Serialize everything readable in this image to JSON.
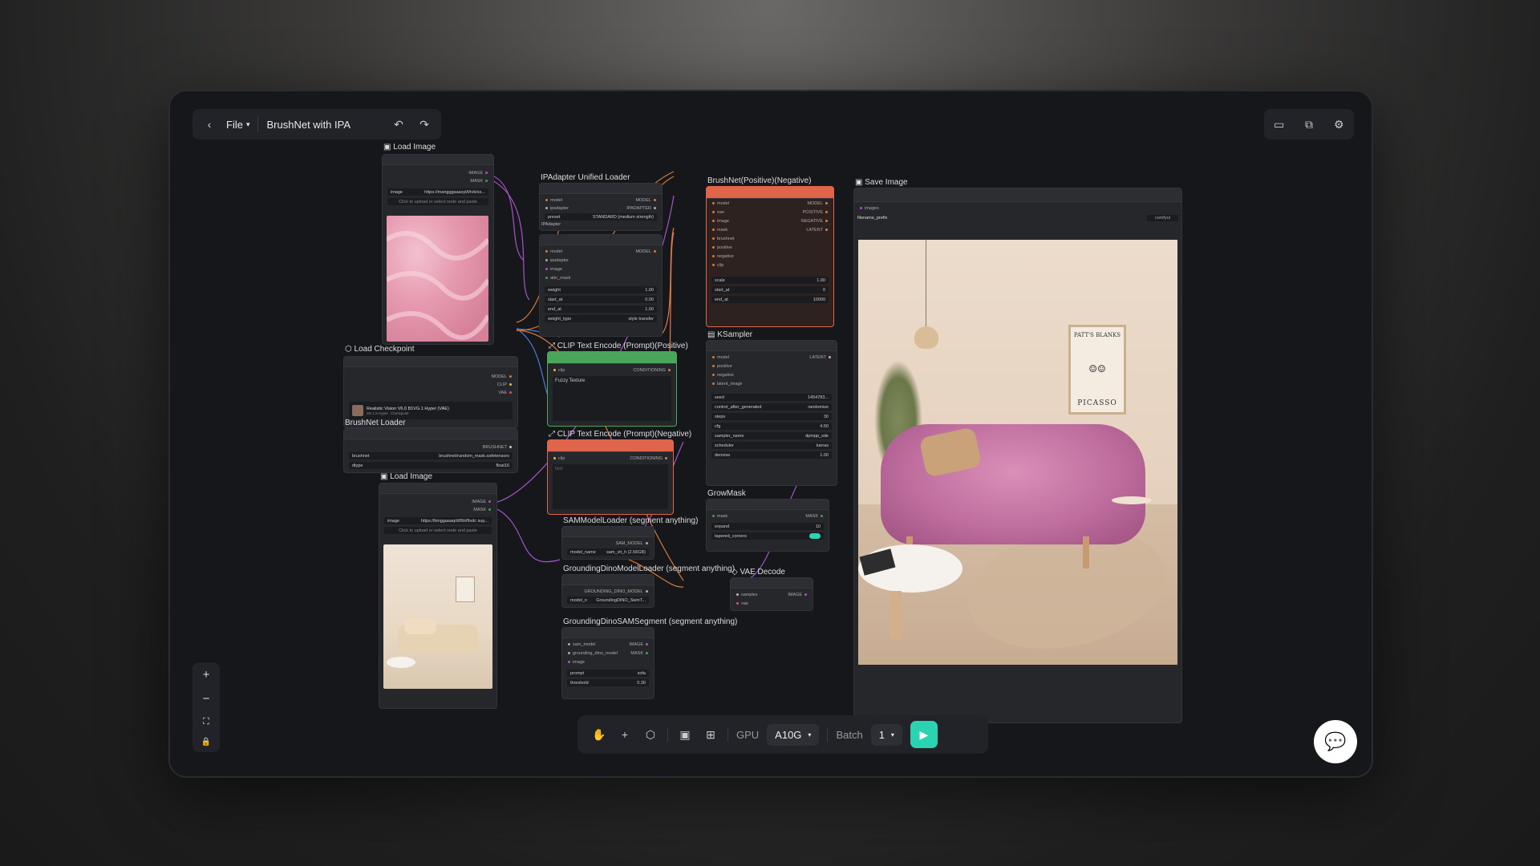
{
  "header": {
    "file_label": "File",
    "workflow_title": "BrushNet with IPA"
  },
  "icons": {
    "back": "chevron-left-icon",
    "undo": "undo-icon",
    "redo": "redo-icon"
  },
  "bottombar": {
    "gpu_label": "GPU",
    "gpu_value": "A10G",
    "batch_label": "Batch",
    "batch_value": "1"
  },
  "nodes": {
    "load_image_1": {
      "title": "Load Image",
      "out_image": "IMAGE",
      "out_mask": "MASK",
      "image_label": "image",
      "image_value": "https://mangggaaasyl/t/tvb/ss...",
      "upload_hint": "Click to upload or select node and paste"
    },
    "load_checkpoint": {
      "title": "Load Checkpoint",
      "out_model": "MODEL",
      "out_clip": "CLIP",
      "out_vae": "VAE",
      "ckpt_name": "Realistic Vision V6.0 B1VG.1 Hyper (VAE)",
      "ckpt_tags": [
        "SD 1.5 Hyper",
        "Checkpoint"
      ]
    },
    "brushnet_loader": {
      "title": "BrushNet Loader",
      "out": "BRUSHNET",
      "brushnet_label": "brushnet",
      "brushnet_value": "brushnet/random_mask.safetensors",
      "dtype_label": "dtype",
      "dtype_value": "float16"
    },
    "load_image_2": {
      "title": "Load Image",
      "out_image": "IMAGE",
      "out_mask": "MASK",
      "image_label": "image",
      "image_value": "https://binggaaaq/d/f/bt/ftvdc sup...",
      "upload_hint": "Click to upload or select node and paste"
    },
    "ipadapter_loader": {
      "title": "IPAdapter Unified Loader",
      "in_model": "model",
      "in_ipadapter": "ipadapter",
      "out_model": "MODEL",
      "out_ipadapter": "IPADAPTER",
      "preset_label": "preset",
      "preset_value": "STANDARD (medium strength)",
      "sub_title": "IPAdapter"
    },
    "ipadapter_apply": {
      "in_model": "model",
      "in_ipadapter": "ipadapter",
      "in_image": "image",
      "in_attn_mask": "attn_mask",
      "out_model": "MODEL",
      "weight_label": "weight",
      "weight_value": "1.00",
      "start_label": "start_at",
      "start_value": "0.00",
      "end_label": "end_at",
      "end_value": "1.00",
      "type_label": "weight_type",
      "type_value": "style transfer"
    },
    "clip_pos": {
      "title": "CLIP Text Encode (Prompt)(Positive)",
      "in_clip": "clip",
      "out": "CONDITIONING",
      "text": "Fuzzy Texture"
    },
    "clip_neg": {
      "title": "CLIP Text Encode (Prompt)(Negative)",
      "in_clip": "clip",
      "out": "CONDITIONING",
      "text": "text"
    },
    "sam_loader": {
      "title": "SAMModelLoader (segment anything)",
      "out": "SAM_MODEL",
      "label": "model_name",
      "value": "sam_vit_h (2.56GB)"
    },
    "gdino_loader": {
      "title": "GroundingDinoModelLoader (segment anything)",
      "out": "GROUNDING_DINO_MODEL",
      "label": "model_n",
      "value": "GroundingDINO_SwinT..."
    },
    "gdino_seg": {
      "title": "GroundingDinoSAMSegment (segment anything)",
      "in_sam": "sam_model",
      "in_gdino": "grounding_dino_model",
      "in_image": "image",
      "out_image": "IMAGE",
      "out_mask": "MASK",
      "prompt_label": "prompt",
      "prompt_value": "sofa",
      "threshold_label": "threshold",
      "threshold_value": "0.30"
    },
    "brushnet": {
      "title": "BrushNet(Positive)(Negative)",
      "inputs": [
        "model",
        "vae",
        "image",
        "mask",
        "brushnet",
        "positive",
        "negative",
        "clip"
      ],
      "outputs": [
        "MODEL",
        "POSITIVE",
        "NEGATIVE",
        "LATENT"
      ],
      "scale_label": "scale",
      "scale_value": "1.00",
      "start_label": "start_at",
      "start_value": "0",
      "end_label": "end_at",
      "end_value": "10000"
    },
    "ksampler": {
      "title": "KSampler",
      "inputs": [
        "model",
        "positive",
        "negative",
        "latent_image"
      ],
      "out": "LATENT",
      "widgets": [
        {
          "label": "seed",
          "value": "1454783..."
        },
        {
          "label": "control_after_generated",
          "value": "randomize"
        },
        {
          "label": "steps",
          "value": "30"
        },
        {
          "label": "cfg",
          "value": "4.50"
        },
        {
          "label": "sampler_name",
          "value": "dpmpp_sde"
        },
        {
          "label": "scheduler",
          "value": "karras"
        },
        {
          "label": "denoise",
          "value": "1.00"
        }
      ]
    },
    "growmask": {
      "title": "GrowMask",
      "in_mask": "mask",
      "out": "MASK",
      "expand_label": "expand",
      "expand_value": "10",
      "tapered_label": "tapered_corners"
    },
    "vae_decode": {
      "title": "VAE Decode",
      "in_samples": "samples",
      "in_vae": "vae",
      "out": "IMAGE"
    },
    "save_image": {
      "title": "Save Image",
      "in_images": "images",
      "prefix_label": "filename_prefix",
      "prefix_value": "comfyui"
    }
  },
  "poster": {
    "line1": "PATT'S BLANKS",
    "line2": "PICASSO"
  },
  "colors": {
    "accent_run": "#2ad3b1",
    "node_red": "#e0644a",
    "node_green": "#4aa65a",
    "wire_purple": "#a653c8",
    "wire_orange": "#d77a3a",
    "wire_blue": "#4b7bd6",
    "wire_green": "#3fa05a"
  }
}
